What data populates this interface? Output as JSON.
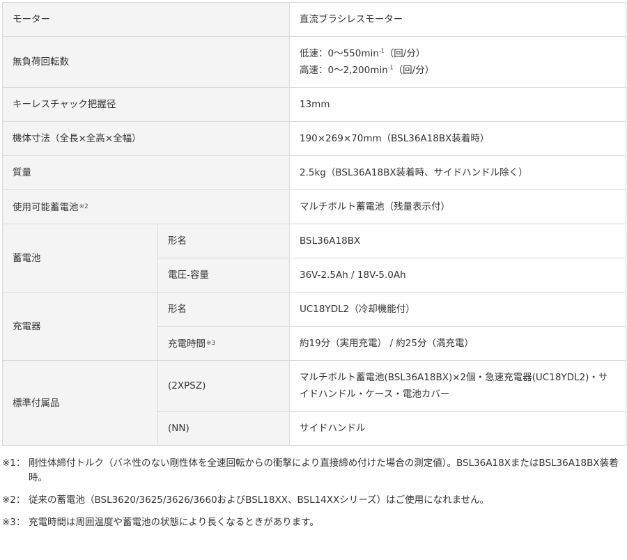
{
  "specs": {
    "motor": {
      "label": "モーター",
      "value": "直流ブラシレスモーター"
    },
    "noload_speed": {
      "label": "無負荷回転数",
      "low_prefix": "低速：0～550min",
      "high_prefix": "高速：0～2,200min",
      "exponent": "-1",
      "unit": "（回/分）"
    },
    "chuck": {
      "label": "キーレスチャック把握径",
      "value": "13mm"
    },
    "dimensions": {
      "label": "機体寸法（全長×全高×全幅）",
      "value": "190×269×70mm（BSL36A18BX装着時）"
    },
    "weight": {
      "label": "質量",
      "value": "2.5kg（BSL36A18BX装着時、サイドハンドル除く）"
    },
    "usable_battery": {
      "label": "使用可能蓄電池",
      "note_mark": "※2",
      "value": "マルチボルト蓄電池（残量表示付）"
    },
    "battery": {
      "label": "蓄電池",
      "model_label": "形名",
      "model_value": "BSL36A18BX",
      "capacity_label": "電圧-容量",
      "capacity_value": "36V-2.5Ah / 18V-5.0Ah"
    },
    "charger": {
      "label": "充電器",
      "model_label": "形名",
      "model_value": "UC18YDL2（冷却機能付）",
      "time_label": "充電時間",
      "time_note_mark": "※3",
      "time_value": "約19分（実用充電） / 約25分（満充電）"
    },
    "accessories": {
      "label": "標準付属品",
      "xpsz_label": "(2XPSZ)",
      "xpsz_value": "マルチボルト蓄電池(BSL36A18BX)×2個・急速充電器(UC18YDL2)・サイドハンドル・ケース・電池カバー",
      "nn_label": "(NN)",
      "nn_value": "サイドハンドル"
    }
  },
  "notes": [
    {
      "mark": "※1：",
      "text": "剛性体締付トルク（バネ性のない剛性体を全速回転からの衝撃により直接締め付けた場合の測定値）。BSL36A18XまたはBSL36A18BX装着時。"
    },
    {
      "mark": "※2：",
      "text": "従来の蓄電池（BSL3620/3625/3626/3660およびBSL18XX、BSL14XXシリーズ）はご使用になれません。"
    },
    {
      "mark": "※3：",
      "text": "充電時間は周囲温度や蓄電池の状態により長くなるときがあります。"
    }
  ]
}
